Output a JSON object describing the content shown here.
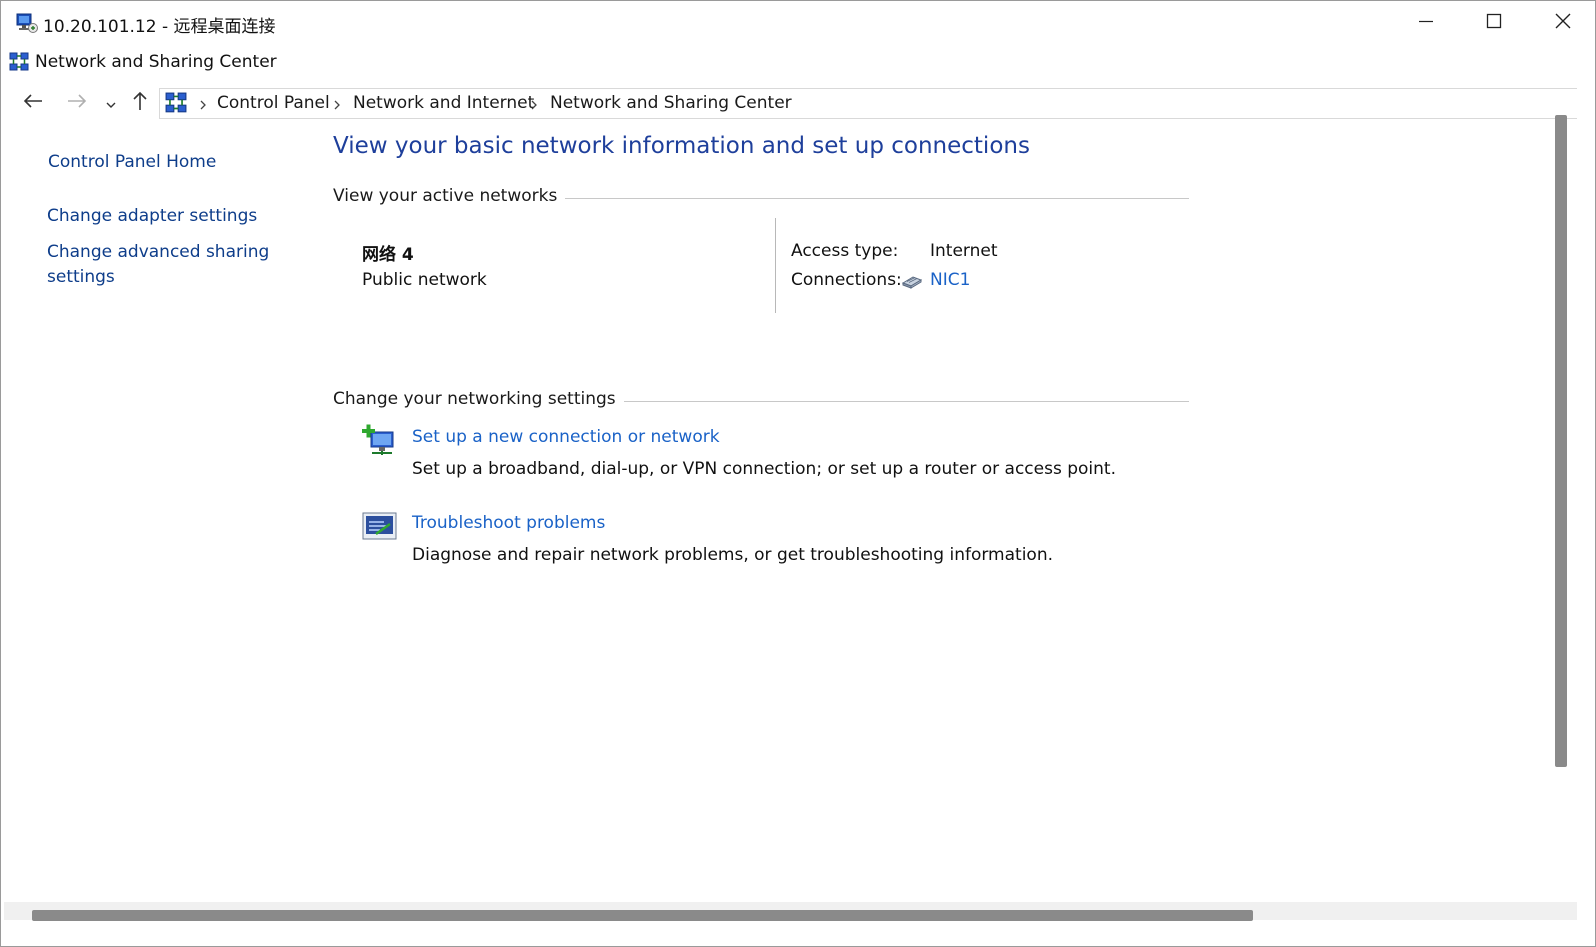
{
  "rdp": {
    "title": "10.20.101.12 - 远程桌面连接",
    "icon": "remote-desktop-icon",
    "buttons": {
      "minimize": "minimize-icon",
      "maximize": "maximize-icon",
      "close": "close-icon"
    }
  },
  "explorer": {
    "title": "Network and Sharing Center",
    "icon": "network-center-icon"
  },
  "nav": {
    "back": "back-arrow-icon",
    "forward": "forward-arrow-icon",
    "recent": "chevron-down-icon",
    "up": "up-arrow-icon"
  },
  "breadcrumb": [
    "Control Panel",
    "Network and Internet",
    "Network and Sharing Center"
  ],
  "leftpane": {
    "home": "Control Panel Home",
    "adapter": "Change adapter settings",
    "sharing": "Change advanced sharing settings"
  },
  "main": {
    "heading": "View your basic network information and set up connections",
    "active_section": "View your active networks",
    "network": {
      "name": "网络 4",
      "kind": "Public network",
      "access_label": "Access type:",
      "access_value": "Internet",
      "connections_label": "Connections:",
      "connection_link": "NIC1"
    },
    "settings_section": "Change your networking settings",
    "tasks": [
      {
        "link": "Set up a new connection or network",
        "desc": "Set up a broadband, dial-up, or VPN connection; or set up a router or access point.",
        "icon": "new-connection-icon"
      },
      {
        "link": "Troubleshoot problems",
        "desc": "Diagnose and repair network problems, or get troubleshooting information.",
        "icon": "troubleshoot-icon"
      }
    ]
  },
  "colors": {
    "heading": "#1e3f9b",
    "link": "#1a62c7",
    "nav_link": "#0e3d8a",
    "rule": "#c8c8c8"
  }
}
